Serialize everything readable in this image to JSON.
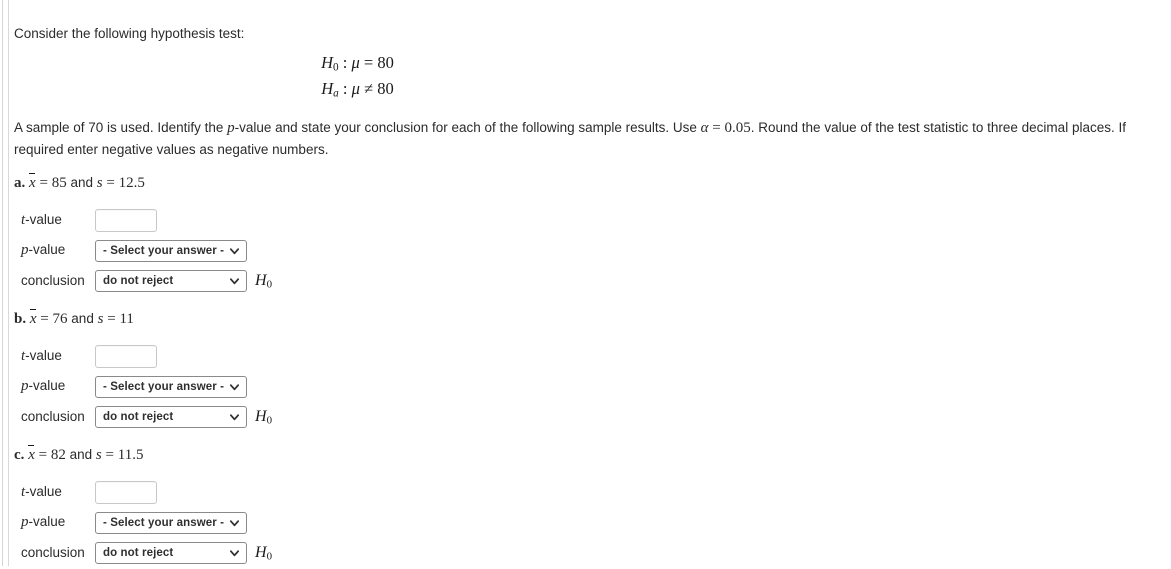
{
  "problem": {
    "intro": "Consider the following hypothesis test:",
    "hypotheses": [
      {
        "symbol": "H",
        "subscript": "0",
        "relation": ":",
        "param": "μ",
        "operator": "=",
        "value": "80"
      },
      {
        "symbol": "H",
        "subscript": "a",
        "relation": ":",
        "param": "μ",
        "operator": "≠",
        "value": "80"
      }
    ],
    "instructions": {
      "segment_1": "A sample of 70 is used. Identify the ",
      "p_italic": "p",
      "segment_2": "-value and state your conclusion for each of the following sample results. Use ",
      "alpha_symbol": "α",
      "alpha_equals": "=",
      "alpha_value": "0.05",
      "segment_3": ". Round the value of the test statistic to three decimal places. If required enter negative values as negative numbers."
    }
  },
  "parts": [
    {
      "letter": "a.",
      "xbar_symbol": "x",
      "xbar_equals": "=",
      "xbar_value": "85",
      "and_word": "and",
      "s_symbol": "s",
      "s_equals": "=",
      "s_value": "12.5",
      "fields": {
        "t_label_var": "t",
        "t_label_rest": "-value",
        "t_value": "",
        "t_placeholder": "",
        "p_label_var": "p",
        "p_label_rest": "-value",
        "p_selected": "- Select your answer -",
        "conclusion_label": "conclusion",
        "conclusion_selected": "do not reject",
        "conclusion_trailing_symbol": "H",
        "conclusion_trailing_subscript": "0"
      }
    },
    {
      "letter": "b.",
      "xbar_symbol": "x",
      "xbar_equals": "=",
      "xbar_value": "76",
      "and_word": "and",
      "s_symbol": "s",
      "s_equals": "=",
      "s_value": "11",
      "fields": {
        "t_label_var": "t",
        "t_label_rest": "-value",
        "t_value": "",
        "t_placeholder": "",
        "p_label_var": "p",
        "p_label_rest": "-value",
        "p_selected": "- Select your answer -",
        "conclusion_label": "conclusion",
        "conclusion_selected": "do not reject",
        "conclusion_trailing_symbol": "H",
        "conclusion_trailing_subscript": "0"
      }
    },
    {
      "letter": "c.",
      "xbar_symbol": "x",
      "xbar_equals": "=",
      "xbar_value": "82",
      "and_word": "and",
      "s_symbol": "s",
      "s_equals": "=",
      "s_value": "11.5",
      "fields": {
        "t_label_var": "t",
        "t_label_rest": "-value",
        "t_value": "",
        "t_placeholder": "",
        "p_label_var": "p",
        "p_label_rest": "-value",
        "p_selected": "- Select your answer -",
        "conclusion_label": "conclusion",
        "conclusion_selected": "do not reject",
        "conclusion_trailing_symbol": "H",
        "conclusion_trailing_subscript": "0"
      }
    }
  ],
  "icons": {
    "dropdown": "chevron-down-icon"
  },
  "colors": {
    "text": "#2b2b2b",
    "math": "#1a1a1a",
    "select_border": "#8a8a8a",
    "input_border": "#c8c8c8",
    "edge_rule": "#d4d4d4",
    "background": "#ffffff"
  }
}
